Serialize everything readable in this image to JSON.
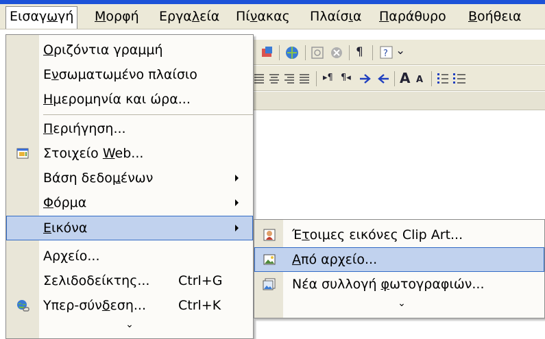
{
  "menubar": {
    "items": [
      {
        "pre": "Εισαγ",
        "key": "ω",
        "post": "γή"
      },
      {
        "pre": "",
        "key": "Μ",
        "post": "ορφή"
      },
      {
        "pre": "Εργα",
        "key": "λ",
        "post": "εία"
      },
      {
        "pre": "Πί",
        "key": "ν",
        "post": "ακας"
      },
      {
        "pre": "Πλαίσ",
        "key": "ι",
        "post": "α"
      },
      {
        "pre": "",
        "key": "Π",
        "post": "αράθυρο"
      },
      {
        "pre": "",
        "key": "Β",
        "post": "οήθεια"
      }
    ]
  },
  "insert_menu": {
    "items": [
      {
        "pre": "",
        "key": "Ο",
        "post": "ριζόντια γραμμή"
      },
      {
        "pre": "Ε",
        "key": "ν",
        "post": "σωματωμένο πλαίσιο"
      },
      {
        "pre": "",
        "key": "Η",
        "post": "μερομηνία και ώρα..."
      },
      {
        "pre": "",
        "key": "Π",
        "post": "εριήγηση..."
      },
      {
        "pre": "Στοιχείο ",
        "key": "W",
        "post": "eb...",
        "icon": "web-component-icon"
      },
      {
        "pre": "Βάση δεδο",
        "key": "μ",
        "post": "ένων",
        "submenu": true
      },
      {
        "pre": "",
        "key": "Φ",
        "post": "όρμα",
        "submenu": true
      },
      {
        "pre": "",
        "key": "Ε",
        "post": "ικόνα",
        "submenu": true,
        "highlighted": true
      },
      {
        "pre": "Αρ",
        "key": "χ",
        "post": "είο..."
      },
      {
        "pre": "Σελιδοδείκτης...",
        "key": "",
        "post": "",
        "shortcut": "Ctrl+G"
      },
      {
        "pre": "Υπερ-σύν",
        "key": "δ",
        "post": "εση...",
        "shortcut": "Ctrl+K",
        "icon": "hyperlink-globe-icon"
      }
    ],
    "expand_glyph": "⌄"
  },
  "picture_submenu": {
    "items": [
      {
        "pre": "Έ",
        "key": "τ",
        "post": "οιμες εικόνες Clip Art...",
        "icon": "clip-art-icon"
      },
      {
        "pre": "",
        "key": "Α",
        "post": "πό αρχείο...",
        "icon": "from-file-picture-icon",
        "highlighted": true
      },
      {
        "pre": "Νέα συλλογή ",
        "key": "φ",
        "post": "ωτογραφιών...",
        "icon": "photo-album-icon"
      }
    ],
    "expand_glyph": "⌄"
  },
  "toolbar": {
    "row1_glyphs": [
      "¶"
    ],
    "row2_glyphs": [
      "A",
      "A"
    ]
  },
  "colors": {
    "menu_highlight": "#c1d2ee",
    "highlight_border": "#316ac5",
    "menubar_bg": "#ece9d8",
    "title_blue": "#1c52d8"
  }
}
